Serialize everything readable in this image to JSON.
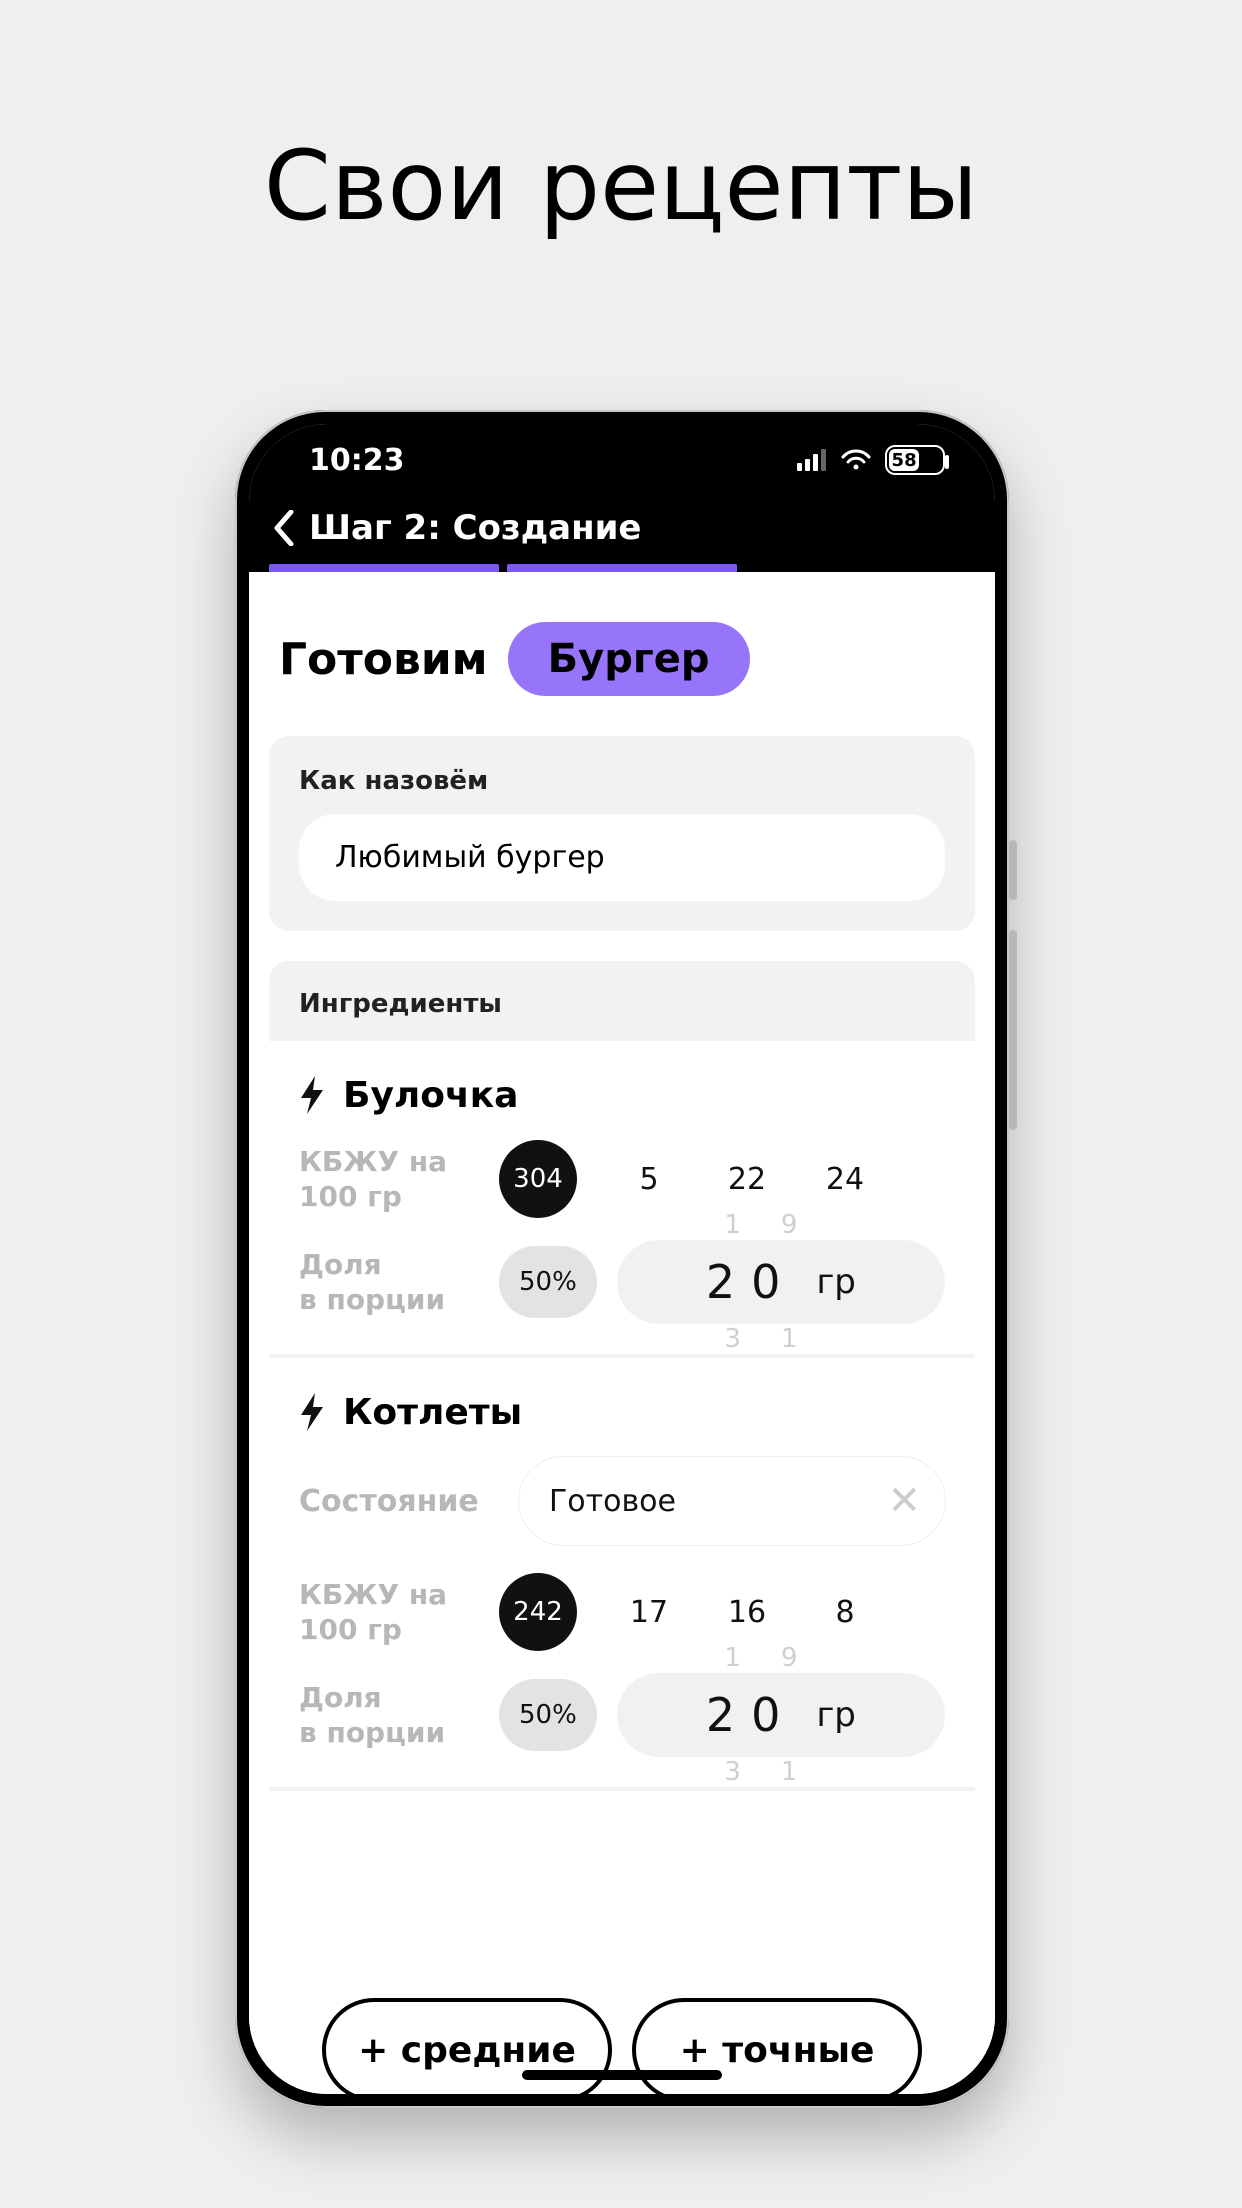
{
  "page_heading": "Свои рецепты",
  "status": {
    "time": "10:23",
    "battery_pct": "58"
  },
  "nav": {
    "title": "Шаг 2: Создание"
  },
  "top": {
    "cooking_label": "Готовим",
    "recipe_type": "Бургер"
  },
  "name_card": {
    "label": "Как назовём",
    "value": "Любимый бургер"
  },
  "ingredients_section_label": "Ингредиенты",
  "kbju_label_line1": "КБЖУ на",
  "kbju_label_line2": "100 гр",
  "share_label_line1": "Доля",
  "share_label_line2": "в порции",
  "ingredients": [
    {
      "name": "Булочка",
      "kcal": "304",
      "p": "5",
      "f": "22",
      "c": "24",
      "share_pct": "50%",
      "portion_value": "20",
      "portion_unit": "гр",
      "ghost_top": "19",
      "ghost_bot": "31"
    },
    {
      "name": "Котлеты",
      "state_label": "Состояние",
      "state_value": "Готовое",
      "kcal": "242",
      "p": "17",
      "f": "16",
      "c": "8",
      "share_pct": "50%",
      "portion_value": "20",
      "portion_unit": "гр",
      "ghost_top": "19",
      "ghost_bot": "31"
    }
  ],
  "bottom_buttons": {
    "avg": "+ средние",
    "exact": "+ точные"
  }
}
